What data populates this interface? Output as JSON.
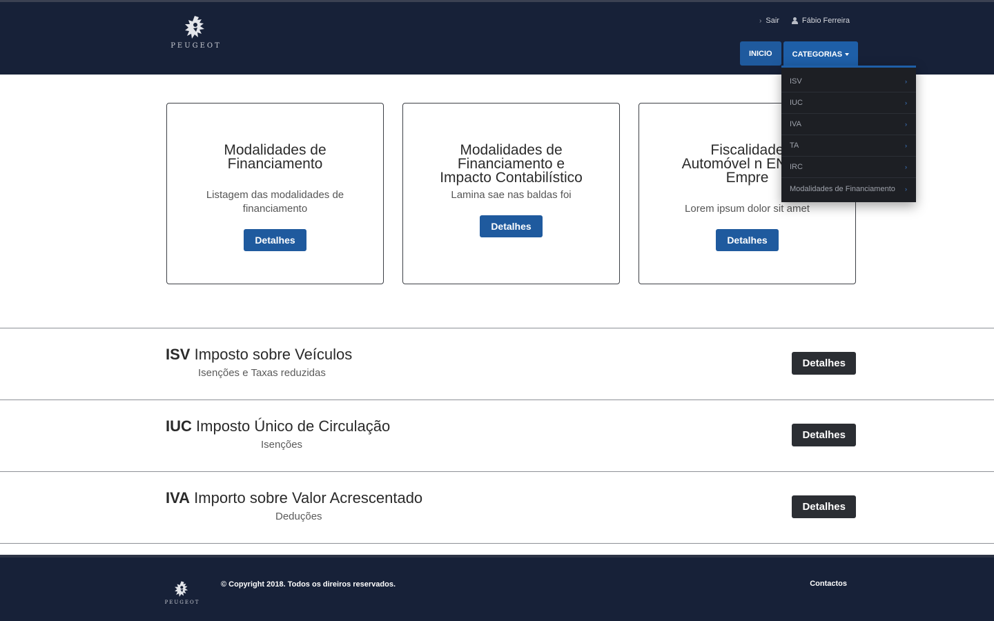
{
  "header": {
    "brand": "PEUGEOT",
    "logout_label": "Sair",
    "user_name": "Fábio Ferreira",
    "nav": {
      "home_label": "INICIO",
      "categories_label": "CATEGORIAS"
    }
  },
  "dropdown": {
    "items": [
      {
        "label": "ISV"
      },
      {
        "label": "IUC"
      },
      {
        "label": "IVA"
      },
      {
        "label": "TA"
      },
      {
        "label": "IRC"
      },
      {
        "label": "Modalidades de Financiamento"
      }
    ]
  },
  "cards": [
    {
      "title": "Modalidades de Financiamento",
      "description": "Listagem das modalidades de financiamento",
      "button": "Detalhes"
    },
    {
      "title": "Modalidades de Financiamento e Impacto Contabilístico",
      "description": "Lamina sae nas baldas foi",
      "button": "Detalhes"
    },
    {
      "title": "Fiscalidade Automóvel n ENI’s e Empre",
      "description": "Lorem ipsum dolor sit amet",
      "button": "Detalhes"
    }
  ],
  "sections": [
    {
      "code": "ISV",
      "title": "Imposto sobre Veículos",
      "subtitle": "Isenções e Taxas reduzidas",
      "button": "Detalhes"
    },
    {
      "code": "IUC",
      "title": "Imposto Único de Circulação",
      "subtitle": "Isenções",
      "button": "Detalhes"
    },
    {
      "code": "IVA",
      "title": "Importo sobre Valor Acrescentado",
      "subtitle": "Deduções",
      "button": "Detalhes"
    }
  ],
  "footer": {
    "brand": "PEUGEOT",
    "copyright": "© Copyright 2018. Todos os direiros reservados.",
    "contacts_label": "Contactos"
  },
  "colors": {
    "header_bg": "#172138",
    "primary_blue": "#1f5a9e",
    "dark_button": "#2b2e33",
    "dropdown_bg": "#1d1f24"
  },
  "icons": {
    "logo": "peugeot-lion-icon",
    "logout": "chevron-right-icon",
    "user": "user-icon",
    "submenu": "chevron-right-icon"
  }
}
